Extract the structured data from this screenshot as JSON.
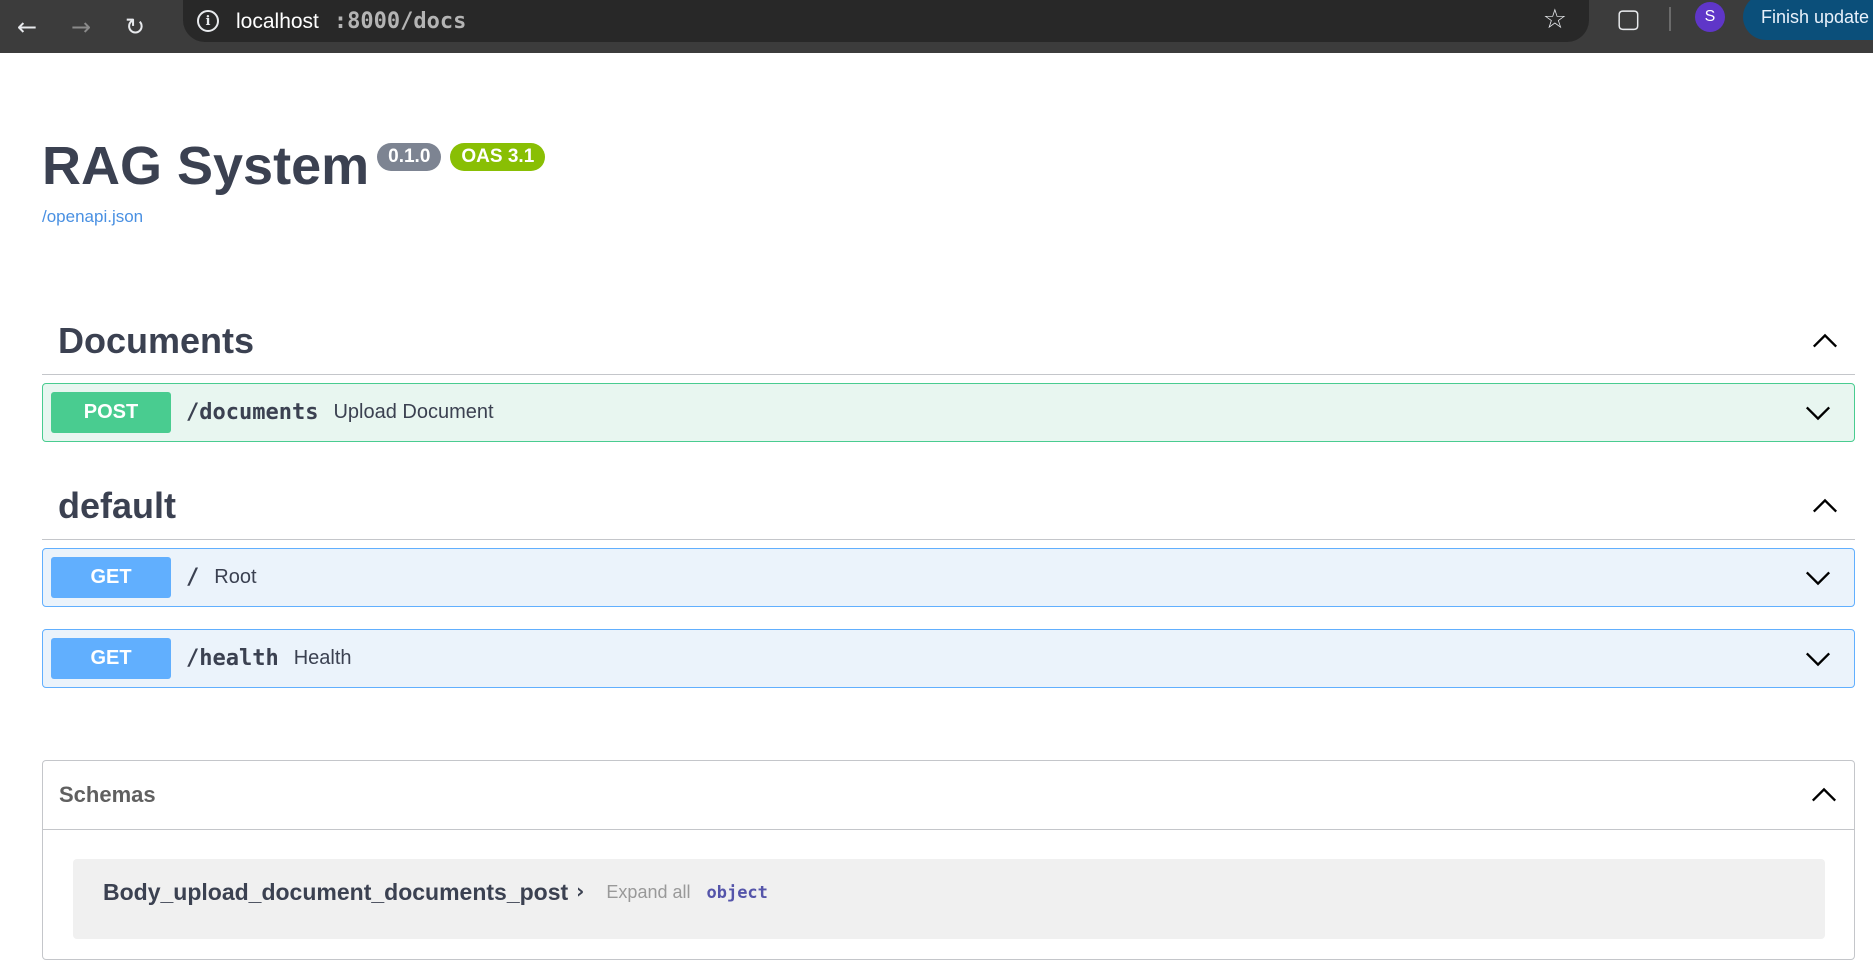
{
  "browser": {
    "back_icon": "arrow-left",
    "forward_icon": "arrow-right",
    "reload_icon": "reload",
    "url_host": "localhost",
    "url_path": ":8000/docs",
    "finish_update_label": "Finish update",
    "profile_initial": "S"
  },
  "header": {
    "title": "RAG System",
    "version_badge": "0.1.0",
    "oas_badge": "OAS 3.1",
    "spec_link": "/openapi.json"
  },
  "tags": [
    {
      "name": "Documents",
      "operations": [
        {
          "method": "POST",
          "path": "/documents",
          "summary": "Upload Document"
        }
      ]
    },
    {
      "name": "default",
      "operations": [
        {
          "method": "GET",
          "path": "/",
          "summary": "Root"
        },
        {
          "method": "GET",
          "path": "/health",
          "summary": "Health"
        }
      ]
    }
  ],
  "schemas": {
    "title": "Schemas",
    "items": [
      {
        "name": "Body_upload_document_documents_post",
        "expand_label": "Expand all",
        "type": "object"
      }
    ]
  },
  "colors": {
    "post": "#49cc90",
    "get": "#61affe",
    "version_badge": "#7d8492",
    "oas_badge": "#89bf04",
    "link": "#4990e2"
  }
}
